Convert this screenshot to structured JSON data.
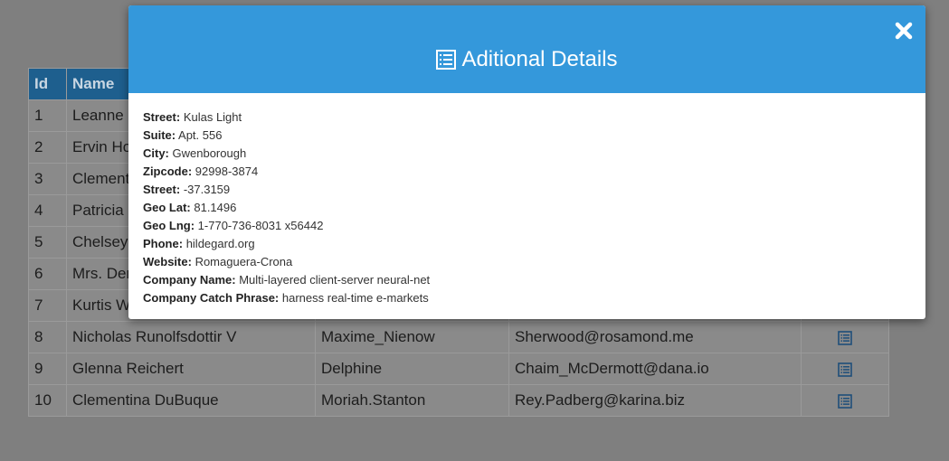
{
  "table": {
    "headers": {
      "id": "Id",
      "name": "Name"
    },
    "rows": [
      {
        "id": "1",
        "name": "Leanne Graham",
        "username": "",
        "email": ""
      },
      {
        "id": "2",
        "name": "Ervin Howell",
        "username": "",
        "email": ""
      },
      {
        "id": "3",
        "name": "Clementine Bauch",
        "username": "",
        "email": ""
      },
      {
        "id": "4",
        "name": "Patricia Lebsack",
        "username": "",
        "email": ""
      },
      {
        "id": "5",
        "name": "Chelsey Dietrich",
        "username": "",
        "email": ""
      },
      {
        "id": "6",
        "name": "Mrs. Dennis Schulist",
        "username": "",
        "email": ""
      },
      {
        "id": "7",
        "name": "Kurtis Weissnat",
        "username": "",
        "email": ""
      },
      {
        "id": "8",
        "name": "Nicholas Runolfsdottir V",
        "username": "Maxime_Nienow",
        "email": "Sherwood@rosamond.me"
      },
      {
        "id": "9",
        "name": "Glenna Reichert",
        "username": "Delphine",
        "email": "Chaim_McDermott@dana.io"
      },
      {
        "id": "10",
        "name": "Clementina DuBuque",
        "username": "Moriah.Stanton",
        "email": "Rey.Padberg@karina.biz"
      }
    ],
    "details_icon": "list-icon"
  },
  "modal": {
    "title": "Aditional Details",
    "title_icon": "list-icon",
    "close_icon": "close-icon",
    "fields": [
      {
        "label": "Street:",
        "value": "Kulas Light"
      },
      {
        "label": "Suite:",
        "value": "Apt. 556"
      },
      {
        "label": "City:",
        "value": "Gwenborough"
      },
      {
        "label": "Zipcode:",
        "value": "92998-3874"
      },
      {
        "label": "Street:",
        "value": "-37.3159"
      },
      {
        "label": "Geo Lat:",
        "value": "81.1496"
      },
      {
        "label": "Geo Lng:",
        "value": "1-770-736-8031 x56442"
      },
      {
        "label": "Phone:",
        "value": "hildegard.org"
      },
      {
        "label": "Website:",
        "value": "Romaguera-Crona"
      },
      {
        "label": "Company Name:",
        "value": "Multi-layered client-server neural-net"
      },
      {
        "label": "Company Catch Phrase:",
        "value": "harness real-time e-markets"
      }
    ]
  },
  "colors": {
    "modal_header": "#3498db",
    "table_header": "#1e5f8e",
    "overlay": "#7f7f7f"
  }
}
